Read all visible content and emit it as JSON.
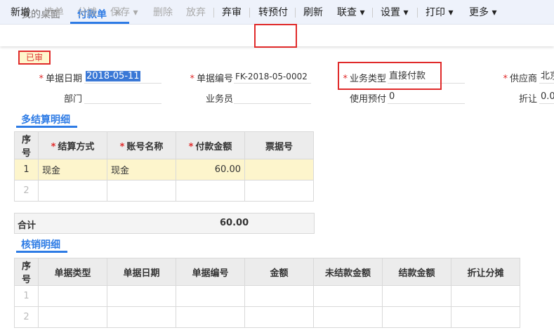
{
  "tabs": [
    {
      "label": "我的桌面"
    },
    {
      "label": "付款单"
    }
  ],
  "toolbar": [
    {
      "label": "新增",
      "disabled": false
    },
    {
      "label": "选单",
      "disabled": true
    },
    {
      "label": "分摊",
      "disabled": true
    },
    {
      "label": "保存 ▾",
      "disabled": true
    },
    {
      "label": "删除",
      "disabled": true
    },
    {
      "label": "放弃",
      "disabled": true
    },
    {
      "label": "弃审",
      "disabled": false
    },
    {
      "label": "转预付",
      "disabled": false
    },
    {
      "label": "刷新",
      "disabled": false
    },
    {
      "label": "联查 ▾",
      "disabled": false
    },
    {
      "label": "设置 ▾",
      "disabled": false
    },
    {
      "label": "打印 ▾",
      "disabled": false
    },
    {
      "label": "更多 ▾",
      "disabled": false
    }
  ],
  "status_badge": "已审",
  "form": {
    "date_label": "单据日期",
    "date_value": "2018-05-11",
    "number_label": "单据编号",
    "number_value": "FK-2018-05-0002",
    "biztype_label": "业务类型",
    "biztype_value": "直接付款",
    "supplier_label": "供应商",
    "supplier_value": "北京",
    "dept_label": "部门",
    "dept_value": "",
    "staff_label": "业务员",
    "staff_value": "",
    "prepay_label": "使用预付",
    "prepay_value": "0",
    "discount_label": "折让",
    "discount_value": "0.0"
  },
  "settle": {
    "title": "多结算明细",
    "headers": [
      "序号",
      "结算方式",
      "账号名称",
      "付款金额",
      "票据号"
    ],
    "rows": [
      [
        "1",
        "现金",
        "现金",
        "60.00",
        ""
      ],
      [
        "2",
        "",
        "",
        "",
        ""
      ]
    ],
    "total_label": "合计",
    "total_value": "60.00"
  },
  "verify": {
    "title": "核销明细",
    "headers": [
      "序号",
      "单据类型",
      "单据日期",
      "单据编号",
      "金额",
      "未结款金额",
      "结款金额",
      "折让分摊"
    ],
    "rows": [
      [
        "1",
        "",
        "",
        "",
        "",
        "",
        "",
        ""
      ],
      [
        "2",
        "",
        "",
        "",
        "",
        "",
        "",
        ""
      ]
    ]
  }
}
